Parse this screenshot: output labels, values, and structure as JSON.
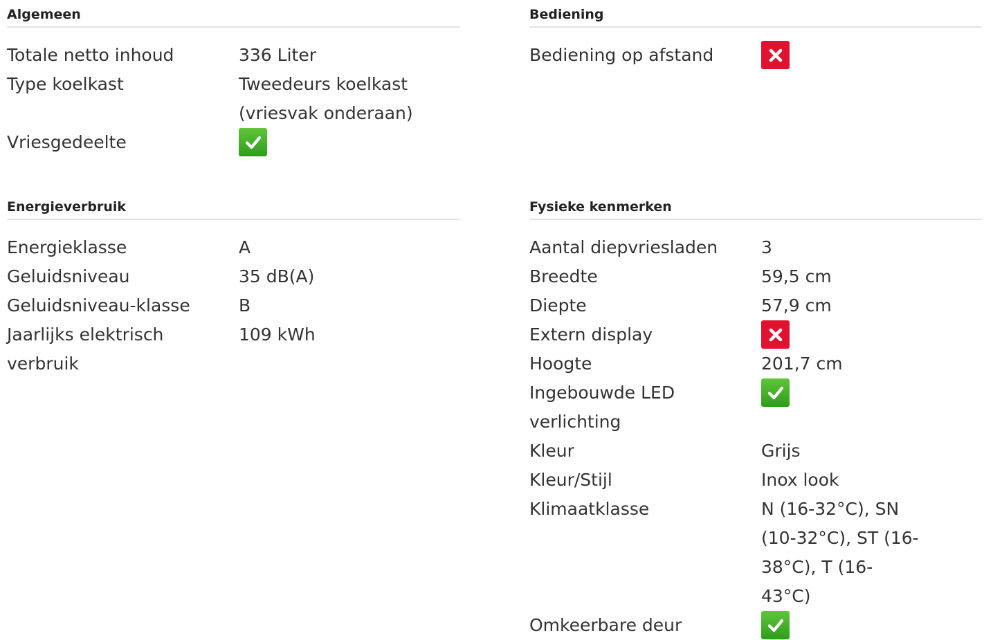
{
  "colors": {
    "yes": "#3aaf25",
    "no": "#e0122f"
  },
  "algemeen": {
    "title": "Algemeen",
    "rows": [
      {
        "label": "Totale netto inhoud",
        "value": "336 Liter"
      },
      {
        "label": "Type koelkast",
        "value": "Tweedeurs koelkast (vriesvak onderaan)"
      },
      {
        "label": "Vriesgedeelte",
        "icon": "check-icon"
      }
    ]
  },
  "bediening": {
    "title": "Bediening",
    "rows": [
      {
        "label": "Bediening op afstand",
        "icon": "cross-icon"
      }
    ]
  },
  "energie": {
    "title": "Energieverbruik",
    "rows": [
      {
        "label": "Energieklasse",
        "value": "A"
      },
      {
        "label": "Geluidsniveau",
        "value": "35 dB(A)"
      },
      {
        "label": "Geluidsniveau-klasse",
        "value": "B"
      },
      {
        "label": "Jaarlijks elektrisch verbruik",
        "value": "109 kWh"
      }
    ]
  },
  "fysiek": {
    "title": "Fysieke kenmerken",
    "rows": [
      {
        "label": "Aantal diepvriesladen",
        "value": "3"
      },
      {
        "label": "Breedte",
        "value": "59,5 cm"
      },
      {
        "label": "Diepte",
        "value": "57,9 cm"
      },
      {
        "label": "Extern display",
        "icon": "cross-icon"
      },
      {
        "label": "Hoogte",
        "value": "201,7 cm"
      },
      {
        "label": "Ingebouwde LED verlichting",
        "icon": "check-icon"
      },
      {
        "label": "Kleur",
        "value": "Grijs"
      },
      {
        "label": "Kleur/Stijl",
        "value": "Inox look"
      },
      {
        "label": "Klimaatklasse",
        "value": "N (16-32°C), SN (10-32°C), ST (16-38°C), T (16-43°C)"
      },
      {
        "label": "Omkeerbare deur",
        "icon": "check-icon"
      }
    ]
  }
}
